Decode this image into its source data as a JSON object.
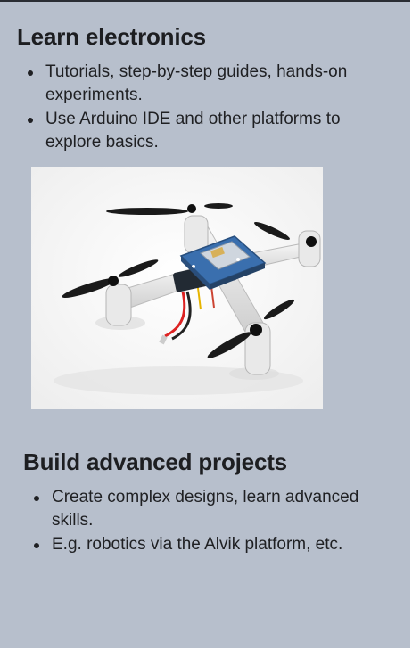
{
  "sections": [
    {
      "title": "Learn electronics",
      "bullets": [
        "Tutorials, step-by-step guides, hands-on experiments.",
        "Use Arduino IDE and other platforms to explore basics."
      ]
    },
    {
      "title": "Build advanced projects",
      "bullets": [
        "Create complex designs, learn advanced skills.",
        "E.g. robotics via the Alvik platform, etc."
      ]
    }
  ],
  "image": {
    "subject": "quadcopter-drone-photo"
  },
  "colors": {
    "panel_background": "#b7bfcc",
    "text": "#1f2023"
  }
}
